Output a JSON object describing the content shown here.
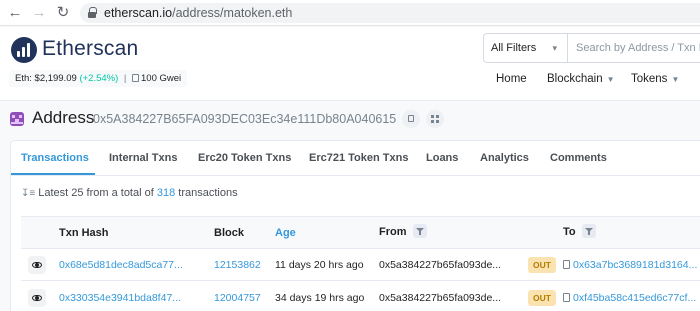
{
  "browser": {
    "url_host": "etherscan.io",
    "url_path": "/address/matoken.eth"
  },
  "header": {
    "brand": "Etherscan",
    "eth_price_label": "Eth: $2,199.09",
    "eth_change": "(+2.54%)",
    "separator": "|",
    "gas": "100 Gwei",
    "filter_label": "All Filters",
    "search_placeholder": "Search by Address / Txn Hash",
    "nav": [
      "Home",
      "Blockchain",
      "Tokens"
    ]
  },
  "address": {
    "title": "Address",
    "hash": "0x5A384227B65FA093DEC03Ec34e111Db80A040615"
  },
  "tabs": [
    "Transactions",
    "Internal Txns",
    "Erc20 Token Txns",
    "Erc721 Token Txns",
    "Loans",
    "Analytics",
    "Comments"
  ],
  "summary": {
    "prefix": "Latest 25 from a total of",
    "count": "318",
    "suffix": "transactions"
  },
  "table": {
    "headers": [
      "Txn Hash",
      "Block",
      "Age",
      "From",
      "To"
    ],
    "rows": [
      {
        "hash": "0x68e5d81dec8ad5ca77...",
        "block": "12153862",
        "age": "11 days 20 hrs ago",
        "from": "0x5a384227b65fa093de...",
        "direction": "OUT",
        "to": "0x63a7bc3689181d3164..."
      },
      {
        "hash": "0x330354e3941bda8f47...",
        "block": "12004757",
        "age": "34 days 19 hrs ago",
        "from": "0x5a384227b65fa093de...",
        "direction": "OUT",
        "to": "0xf45ba58c415ed6c77cf..."
      }
    ]
  },
  "colors": {
    "brand": "#21325b",
    "link": "#3498db",
    "positive": "#00c9a7",
    "out_badge": "#fbe3b1"
  }
}
